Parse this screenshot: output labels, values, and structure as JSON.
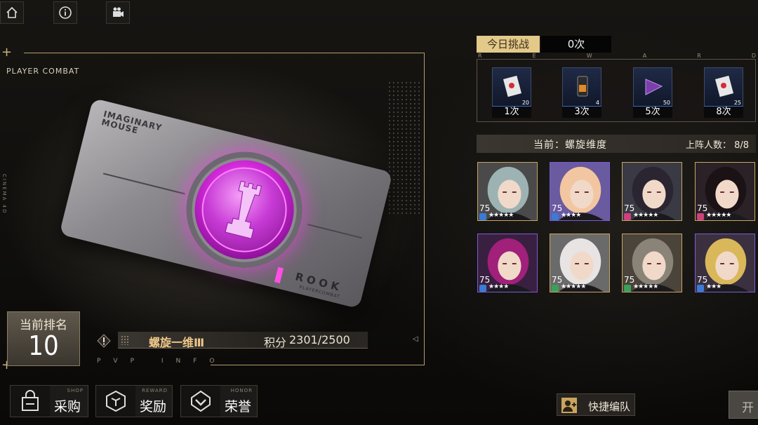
{
  "top_bar": {
    "icons": [
      "home-icon",
      "info-icon",
      "camera-icon"
    ]
  },
  "left_panel": {
    "title": "PLAYER COMBAT",
    "side_text": "CINEMA 4D",
    "card": {
      "name_line1": "IMAGINARY",
      "name_line2": "MOUSE",
      "rank_word": "ROOK",
      "rank_sub": "PLAYERCOMBAT",
      "accent_color": "#ff4fe4"
    },
    "rank": {
      "title": "当前排名",
      "value": "10"
    },
    "info": {
      "dimension": "螺旋一维Ⅲ",
      "score_label": "积分",
      "score_value": "2301/2500",
      "footer": "PVP INFO"
    }
  },
  "bottom_nav": [
    {
      "sub": "SHOP",
      "label": "采购",
      "icon": "shop-bag-icon"
    },
    {
      "sub": "REWARD",
      "label": "奖励",
      "icon": "reward-cube-icon"
    },
    {
      "sub": "HONOR",
      "label": "荣誉",
      "icon": "honor-badge-icon"
    }
  ],
  "right_panel": {
    "today_tab": "今日挑战",
    "today_count": "0次",
    "reward_letters": [
      "R",
      "E",
      "W",
      "A",
      "R",
      "D"
    ],
    "rewards": [
      {
        "qty": "20",
        "label": "1次",
        "icon": "card-pack-icon"
      },
      {
        "qty": "4",
        "label": "3次",
        "icon": "battery-icon"
      },
      {
        "qty": "50",
        "label": "5次",
        "icon": "purple-shard-icon"
      },
      {
        "qty": "25",
        "label": "8次",
        "icon": "card-pack-icon"
      }
    ],
    "current_label": "当前：螺旋维度",
    "deploy_label": "上阵人数：",
    "deploy_count": "8/8",
    "characters": [
      {
        "level": "75",
        "stars": "★★★★★",
        "element_color": "#3a7bd5",
        "frame": "gold"
      },
      {
        "level": "75",
        "stars": "★★★★",
        "element_color": "#3a7bd5",
        "frame": "purple"
      },
      {
        "level": "75",
        "stars": "★★★★★",
        "element_color": "#d0407a",
        "frame": "gold"
      },
      {
        "level": "75",
        "stars": "★★★★★",
        "element_color": "#d0407a",
        "frame": "gold"
      },
      {
        "level": "75",
        "stars": "★★★★",
        "element_color": "#3a7bd5",
        "frame": "purple"
      },
      {
        "level": "75",
        "stars": "★★★★★",
        "element_color": "#3aa05a",
        "frame": "gold"
      },
      {
        "level": "75",
        "stars": "★★★★★",
        "element_color": "#3aa05a",
        "frame": "gold"
      },
      {
        "level": "75",
        "stars": "★★★",
        "element_color": "#3a7bd5",
        "frame": "purple"
      }
    ]
  },
  "actions": {
    "quick_team": "快捷编队",
    "start": "开"
  }
}
